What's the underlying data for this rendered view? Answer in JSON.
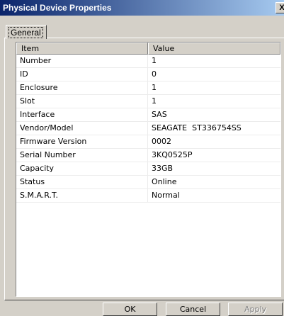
{
  "window": {
    "title": "Physical Device Properties",
    "close_label": "X"
  },
  "tabs": [
    {
      "label": "General"
    }
  ],
  "list": {
    "columns": [
      {
        "label": "Item"
      },
      {
        "label": "Value"
      }
    ],
    "rows": [
      {
        "item": "Number",
        "value": "1"
      },
      {
        "item": "ID",
        "value": "0"
      },
      {
        "item": "Enclosure",
        "value": "1"
      },
      {
        "item": "Slot",
        "value": "1"
      },
      {
        "item": "Interface",
        "value": "SAS"
      },
      {
        "item": "Vendor/Model",
        "value": "SEAGATE  ST336754SS"
      },
      {
        "item": "Firmware Version",
        "value": "0002"
      },
      {
        "item": "Serial Number",
        "value": "3KQ0525P"
      },
      {
        "item": "Capacity",
        "value": "33GB"
      },
      {
        "item": "Status",
        "value": "Online"
      },
      {
        "item": "S.M.A.R.T.",
        "value": "Normal"
      }
    ]
  },
  "buttons": {
    "ok": "OK",
    "cancel": "Cancel",
    "apply": "Apply"
  }
}
